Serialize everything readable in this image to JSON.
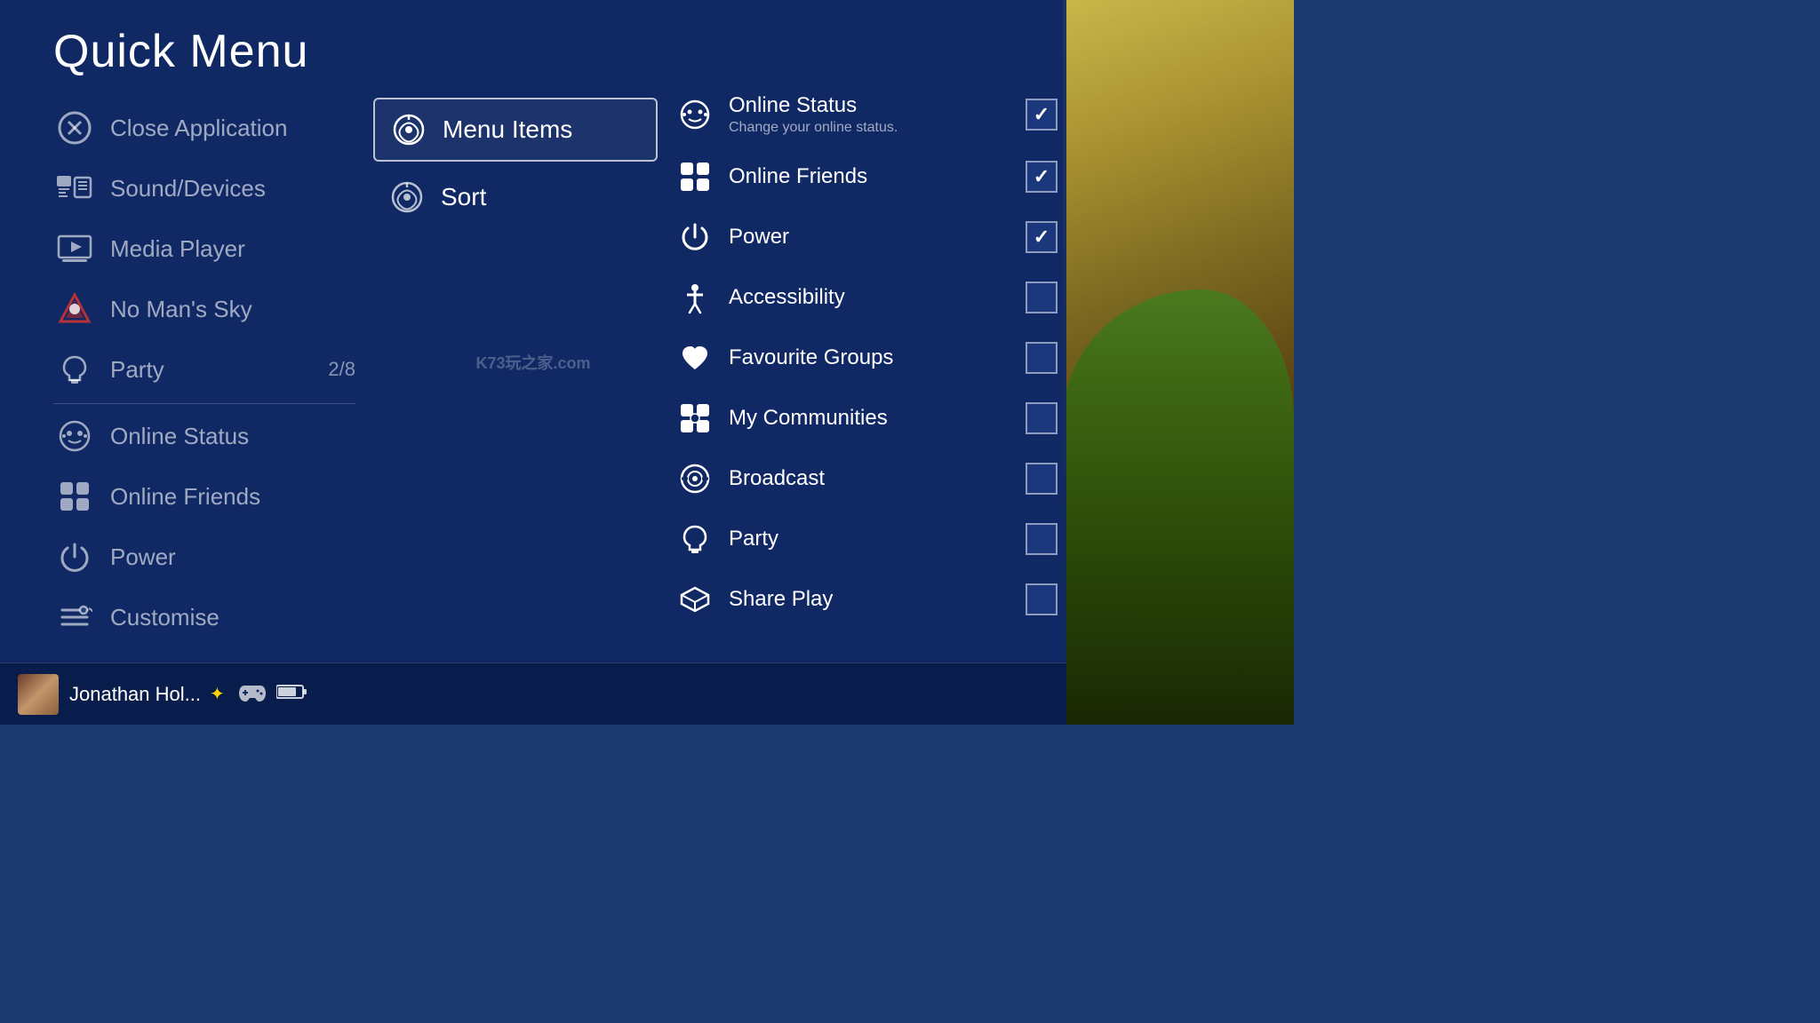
{
  "page": {
    "title": "Quick Menu"
  },
  "left_column": {
    "items": [
      {
        "id": "close-app",
        "label": "Close Application",
        "icon": "close-circle",
        "badge": ""
      },
      {
        "id": "sound-devices",
        "label": "Sound/Devices",
        "icon": "keyboard",
        "badge": ""
      },
      {
        "id": "media-player",
        "label": "Media Player",
        "icon": "media",
        "badge": ""
      },
      {
        "id": "no-mans-sky",
        "label": "No Man's Sky",
        "icon": "game",
        "badge": ""
      },
      {
        "id": "party",
        "label": "Party",
        "icon": "headset",
        "badge": "2/8",
        "divider": true
      },
      {
        "id": "online-status",
        "label": "Online Status",
        "icon": "face",
        "badge": ""
      },
      {
        "id": "online-friends",
        "label": "Online Friends",
        "icon": "friends",
        "badge": ""
      },
      {
        "id": "power",
        "label": "Power",
        "icon": "power",
        "badge": ""
      },
      {
        "id": "customise",
        "label": "Customise",
        "icon": "customise",
        "badge": ""
      }
    ]
  },
  "middle_column": {
    "items": [
      {
        "id": "menu-items",
        "label": "Menu Items",
        "icon": "wrench",
        "active": true
      },
      {
        "id": "sort",
        "label": "Sort",
        "icon": "wrench2",
        "active": false
      }
    ]
  },
  "right_column": {
    "items": [
      {
        "id": "online-status-r",
        "label": "Online Status",
        "sublabel": "Change your online status.",
        "icon": "face",
        "checked": true
      },
      {
        "id": "online-friends-r",
        "label": "Online Friends",
        "sublabel": "",
        "icon": "friends",
        "checked": true
      },
      {
        "id": "power-r",
        "label": "Power",
        "sublabel": "",
        "icon": "power",
        "checked": true
      },
      {
        "id": "accessibility-r",
        "label": "Accessibility",
        "sublabel": "",
        "icon": "accessibility",
        "checked": false
      },
      {
        "id": "favourite-groups-r",
        "label": "Favourite Groups",
        "sublabel": "",
        "icon": "heart",
        "checked": false
      },
      {
        "id": "my-communities-r",
        "label": "My Communities",
        "sublabel": "",
        "icon": "communities",
        "checked": false
      },
      {
        "id": "broadcast-r",
        "label": "Broadcast",
        "sublabel": "",
        "icon": "broadcast",
        "checked": false
      },
      {
        "id": "party-r",
        "label": "Party",
        "sublabel": "",
        "icon": "headset",
        "checked": false
      },
      {
        "id": "share-play-r",
        "label": "Share Play",
        "sublabel": "",
        "icon": "shareplay",
        "checked": false
      }
    ]
  },
  "bottom_bar": {
    "username": "Jonathan Hol...",
    "psplus": "⊕",
    "controller": "🎮",
    "battery": "🔋"
  },
  "watermark": "K73玩之家.com"
}
